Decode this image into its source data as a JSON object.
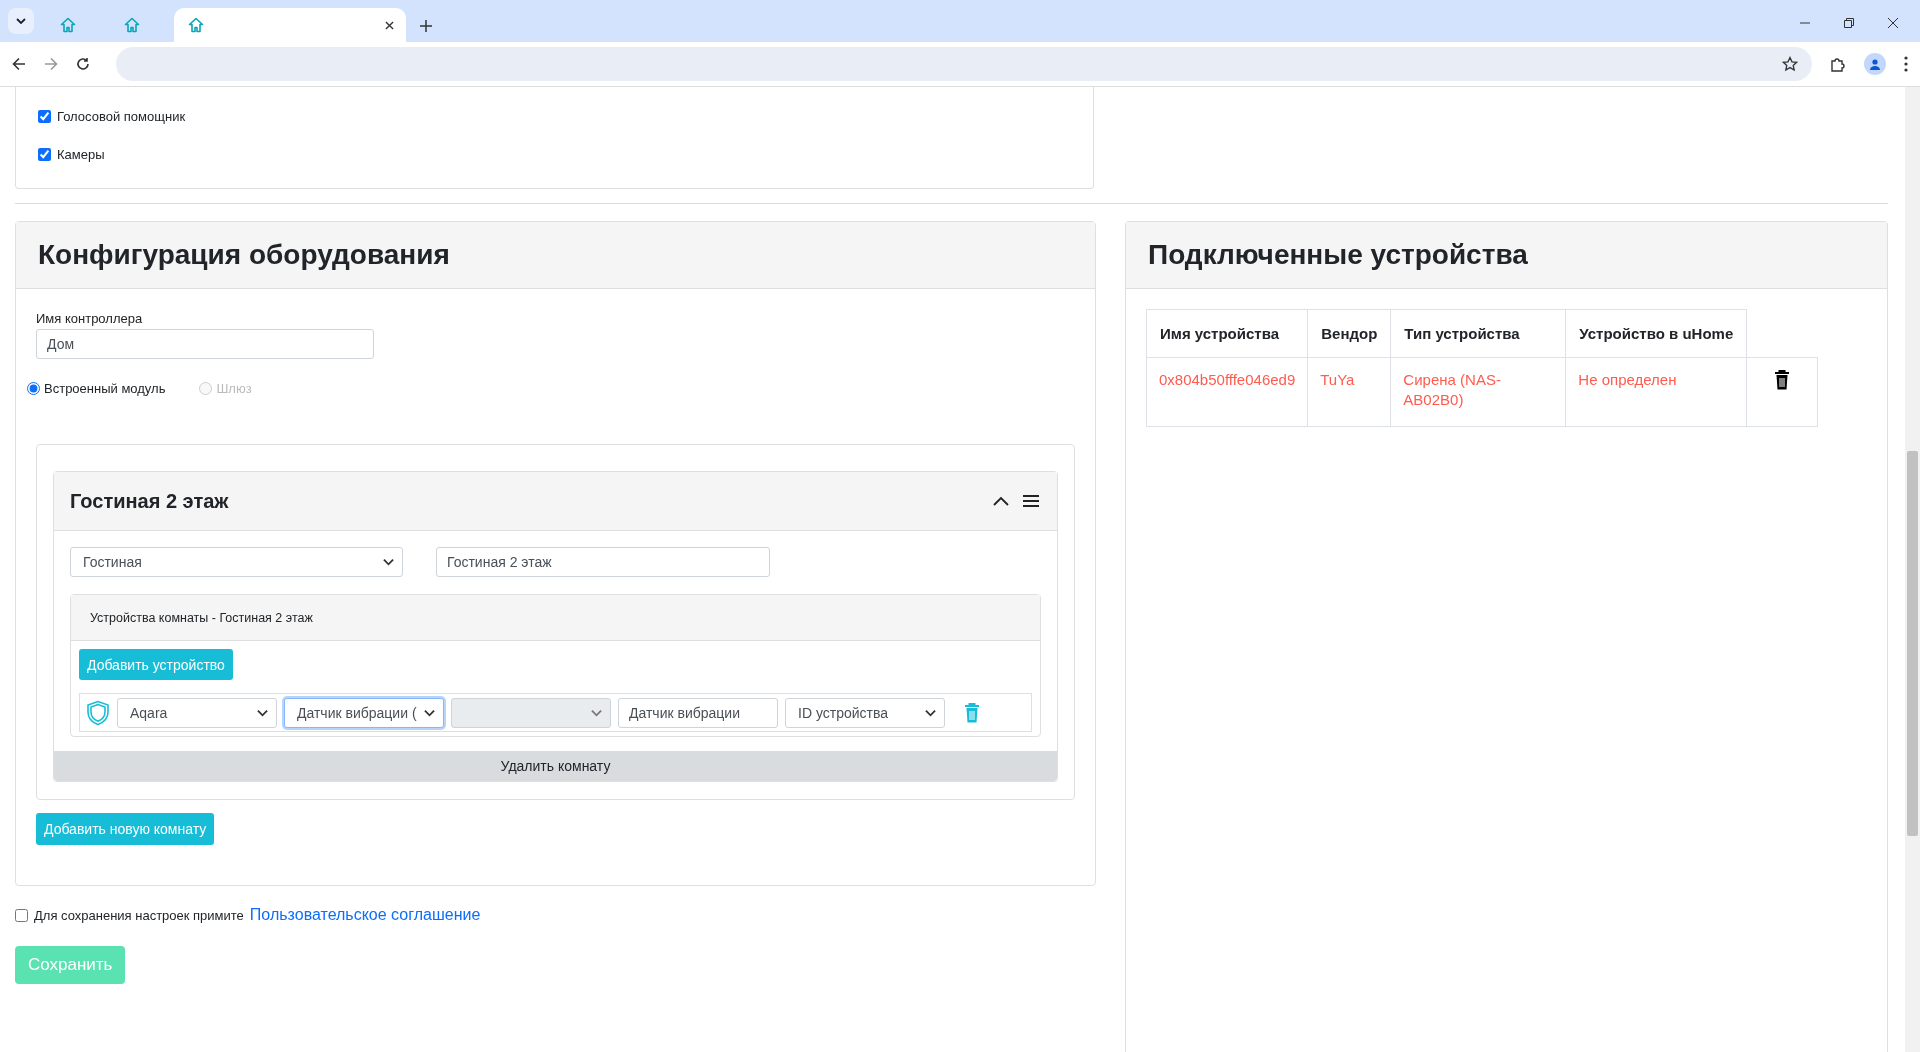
{
  "browser": {
    "tabs": [
      {
        "selected": false
      },
      {
        "selected": false
      },
      {
        "selected": true
      }
    ]
  },
  "features": [
    {
      "label": "Голосовой помощник",
      "checked": true
    },
    {
      "label": "Камеры",
      "checked": true
    }
  ],
  "hardware": {
    "title": "Конфигурация оборудования",
    "controller_label": "Имя контроллера",
    "controller_value": "Дом",
    "modes": [
      {
        "label": "Встроенный модуль",
        "selected": true,
        "disabled": false
      },
      {
        "label": "Шлюз",
        "selected": false,
        "disabled": true
      }
    ],
    "rooms": [
      {
        "title": "Гостиная 2 этаж",
        "room_type": "Гостиная",
        "room_name": "Гостиная 2 этаж",
        "devices_title": "Устройства комнаты - Гостиная 2 этаж",
        "add_device": "Добавить устройство",
        "devices": [
          {
            "fields": [
              {
                "kind": "select",
                "value": "Aqara",
                "focused": false,
                "disabled": false
              },
              {
                "kind": "select",
                "value": "Датчик вибрации (",
                "focused": true,
                "disabled": false
              },
              {
                "kind": "select",
                "focused": false,
                "disabled": true
              },
              {
                "kind": "input",
                "value": "Датчик вибрации",
                "focused": false
              },
              {
                "kind": "select",
                "value": "ID устройства",
                "focused": false,
                "disabled": false
              }
            ]
          }
        ],
        "delete_room": "Удалить комнату"
      }
    ],
    "add_room": "Добавить новую комнату"
  },
  "agreement": {
    "checked": false,
    "text": "Для сохранения настроек примите",
    "link": "Пользовательское соглашение"
  },
  "save": {
    "label": "Сохранить",
    "disabled": true
  },
  "connected": {
    "title": "Подключенные устройства",
    "columns": [
      "Имя устройства",
      "Вендор",
      "Тип устройства",
      "Устройство в uHome"
    ],
    "rows": [
      {
        "cells": [
          "0x804b50fffe046ed9",
          "TuYa",
          "Сирена (NAS-AB02B0)",
          "Не определен"
        ]
      }
    ]
  }
}
